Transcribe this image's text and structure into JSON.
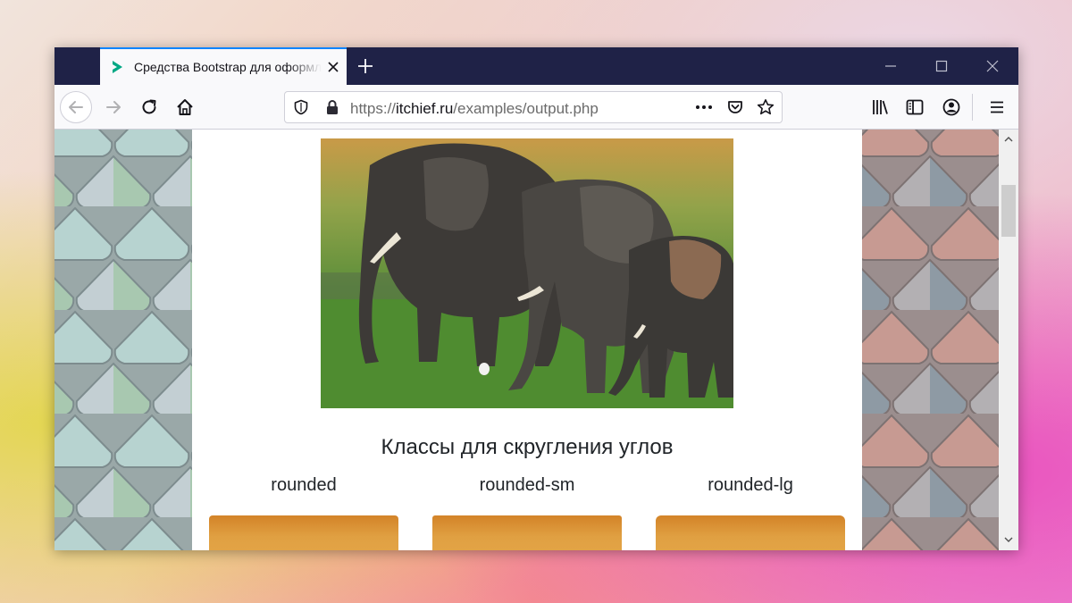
{
  "browser": {
    "tab": {
      "title": "Средства Bootstrap для оформления изображений"
    },
    "url": {
      "prefix": "https://",
      "host": "itchief.ru",
      "path": "/examples/output.php"
    }
  },
  "page": {
    "image_alt": "Elephants",
    "section_title": "Классы для скругления углов",
    "columns": [
      {
        "label": "rounded"
      },
      {
        "label": "rounded-sm"
      },
      {
        "label": "rounded-lg"
      }
    ]
  },
  "colors": {
    "titlebar": "#1f2247",
    "tab_accent": "#0a84ff",
    "favicon": "#00a884",
    "sample_fill": "#e0a042"
  },
  "icons": [
    "favicon-icon",
    "close-icon",
    "plus-icon",
    "minimize-icon",
    "maximize-icon",
    "back-arrow-icon",
    "forward-arrow-icon",
    "reload-icon",
    "home-icon",
    "shield-icon",
    "lock-icon",
    "more-icon",
    "pocket-icon",
    "star-icon",
    "library-icon",
    "sidebar-icon",
    "account-icon",
    "menu-icon",
    "chevron-up-icon",
    "chevron-down-icon"
  ]
}
